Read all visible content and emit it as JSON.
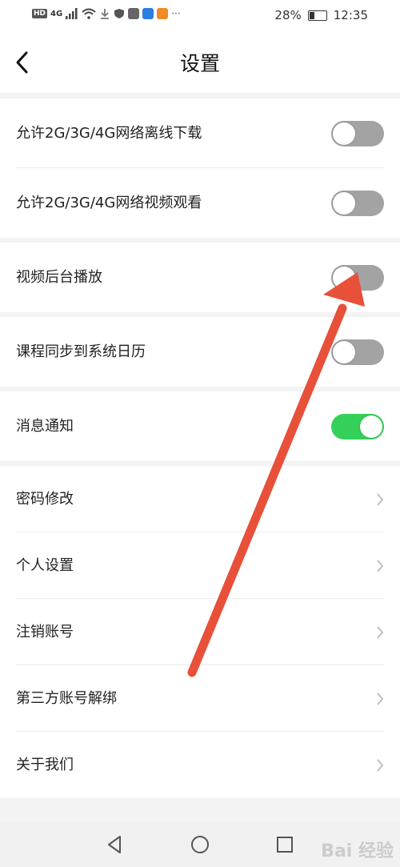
{
  "status_bar": {
    "signal_tag": "HD",
    "network": "4G",
    "icons": [
      "wifi-icon",
      "download-icon",
      "shield-icon",
      "app-icon",
      "app-icon",
      "app-icon",
      "more-icon"
    ],
    "battery_percent": "28%",
    "battery_level": 0.28,
    "time": "12:35"
  },
  "header": {
    "title": "设置",
    "back_icon": "chevron-left-icon"
  },
  "groups": [
    {
      "items": [
        {
          "label": "允许2G/3G/4G网络离线下载",
          "toggle": false
        },
        {
          "label": "允许2G/3G/4G网络视频观看",
          "toggle": false
        }
      ]
    },
    {
      "items": [
        {
          "label": "视频后台播放",
          "toggle": false
        }
      ]
    },
    {
      "items": [
        {
          "label": "课程同步到系统日历",
          "toggle": false
        }
      ]
    },
    {
      "items": [
        {
          "label": "消息通知",
          "toggle": true
        }
      ]
    },
    {
      "items": [
        {
          "label": "密码修改"
        },
        {
          "label": "个人设置"
        },
        {
          "label": "注销账号"
        },
        {
          "label": "第三方账号解绑"
        },
        {
          "label": "关于我们"
        }
      ]
    }
  ],
  "nav_bar": {
    "icons": [
      "back-triangle-icon",
      "home-circle-icon",
      "recent-square-icon"
    ]
  },
  "watermark": "Bai 经验",
  "colors": {
    "toggle_on": "#34d05a",
    "toggle_off": "#a3a3a3",
    "annotation_arrow": "#e8503a"
  }
}
